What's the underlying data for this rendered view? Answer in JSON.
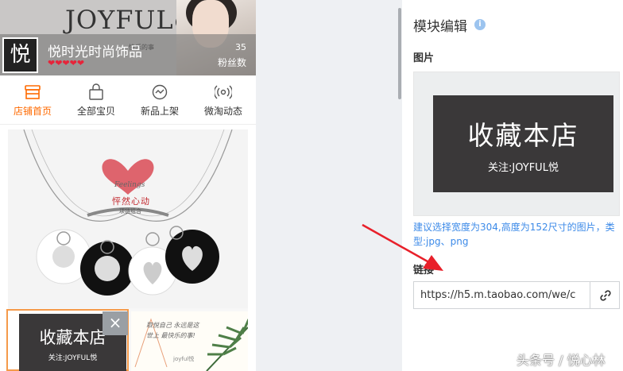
{
  "shop": {
    "brand": "JOYFUL",
    "brand_badge": "悦",
    "tagline": "快乐的事",
    "logo_char": "悦",
    "name": "悦时光时尚饰品",
    "rating_hearts": "❤❤❤❤❤",
    "fans_count": "35",
    "fans_label": "粉丝数"
  },
  "tabs": [
    {
      "label": "店铺首页",
      "icon": "store-icon",
      "active": true
    },
    {
      "label": "全部宝贝",
      "icon": "shopping-bag-icon",
      "active": false
    },
    {
      "label": "新品上架",
      "icon": "new-arrival-icon",
      "active": false
    },
    {
      "label": "微淘动态",
      "icon": "broadcast-icon",
      "active": false
    }
  ],
  "product": {
    "feelings": "Feelings",
    "title": "怦然心动",
    "subtitle": "项链组合"
  },
  "selected_module": {
    "title": "收藏本店",
    "follow": "关注:JOYFUL悦",
    "close": "×"
  },
  "right_card": {
    "text": "取悦自己 永远是这世上 最快乐的事!",
    "signature": "joyful悦"
  },
  "editor": {
    "title": "模块编辑",
    "info_icon": "i",
    "image_label": "图片",
    "preview_title": "收藏本店",
    "preview_follow": "关注:JOYFUL悦",
    "image_hint": "建议选择宽度为304,高度为152尺寸的图片，类型:jpg、png",
    "link_label": "链接",
    "link_value": "https://h5.m.taobao.com/we/c",
    "link_button_icon": "link-icon"
  },
  "watermark": "头条号 / 悦心林",
  "colors": {
    "accent_orange": "#ff6a00",
    "selection_border": "#f59a4a",
    "hint_blue": "#3c8ae8",
    "arrow_red": "#e8202a"
  }
}
